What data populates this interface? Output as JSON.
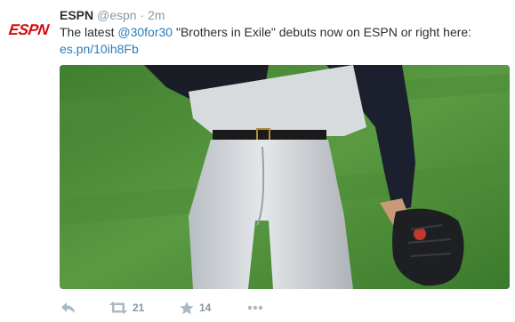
{
  "tweet": {
    "account": {
      "logo_text": "ESPN",
      "name": "ESPN",
      "handle": "@espn",
      "separator": "·",
      "time": "2m"
    },
    "text": {
      "prefix": "The latest ",
      "mention": "@30for30",
      "body": " \"Brothers in Exile\" debuts now on ESPN or right here:",
      "link": "es.pn/10ih8Fb"
    },
    "media": {
      "description_icon": "photo"
    },
    "actions": {
      "reply_icon": "reply-icon",
      "retweet_icon": "retweet-icon",
      "retweet_count": "21",
      "favorite_icon": "star-icon",
      "favorite_count": "14",
      "more_icon": "more-icon"
    },
    "colors": {
      "brand": "#d50a0a",
      "link": "#2b7bb9",
      "muted": "#8899a6",
      "icon": "#aab8c2"
    }
  }
}
